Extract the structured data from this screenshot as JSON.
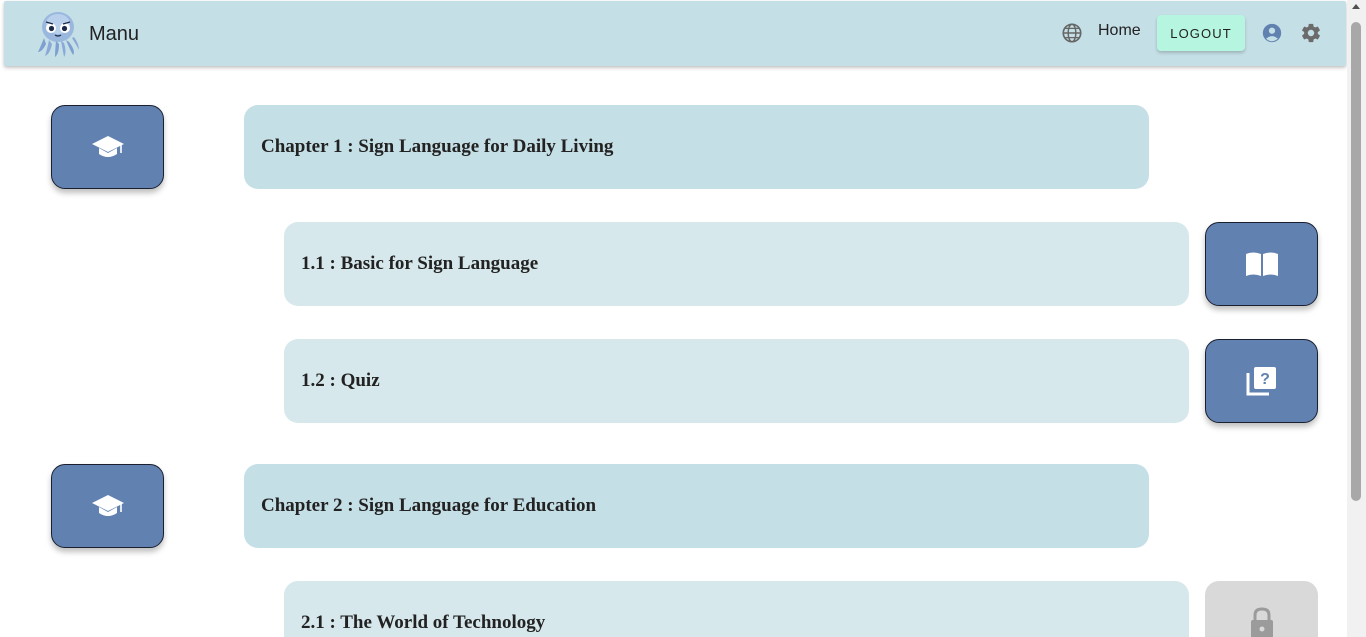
{
  "app": {
    "name": "Manu",
    "logo_icon": "octopus-logo"
  },
  "nav": {
    "language_icon": "globe-icon",
    "home_label": "Home",
    "logout_label": "LOGOUT",
    "account_icon": "account-circle-icon",
    "settings_icon": "gear-icon"
  },
  "curriculum": [
    {
      "kind": "chapter",
      "title": "Chapter 1 : Sign Language for Daily Living",
      "icon": "graduation-cap-icon"
    },
    {
      "kind": "lesson",
      "title": "1.1 : Basic for Sign Language",
      "icon": "open-book-icon",
      "locked": false
    },
    {
      "kind": "lesson",
      "title": "1.2 : Quiz",
      "icon": "quiz-icon",
      "locked": false
    },
    {
      "kind": "chapter",
      "title": "Chapter 2 : Sign Language for Education",
      "icon": "graduation-cap-icon"
    },
    {
      "kind": "lesson",
      "title": "2.1 : The World of Technology",
      "icon": "lock-icon",
      "locked": true
    }
  ],
  "colors": {
    "appbar": "#c5dfe6",
    "chapter_card": "#c5dfe6",
    "lesson_card": "#d6e8ec",
    "tile": "#6181b0",
    "tile_locked": "#d9d9d9",
    "logout_button": "#b6f5e0"
  }
}
